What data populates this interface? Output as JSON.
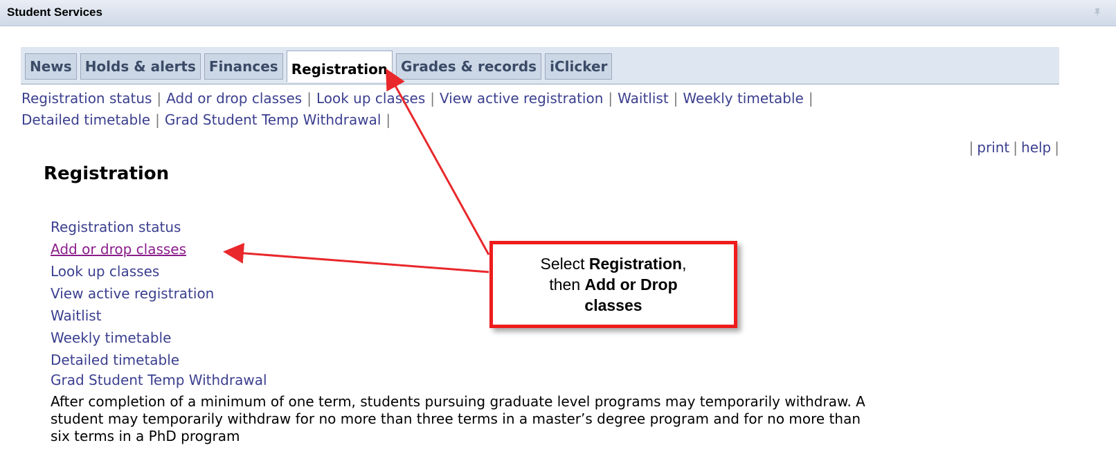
{
  "portlet": {
    "title": "Student Services"
  },
  "tabs": [
    {
      "label": "News",
      "active": false
    },
    {
      "label": "Holds & alerts",
      "active": false
    },
    {
      "label": "Finances",
      "active": false
    },
    {
      "label": "Registration",
      "active": true
    },
    {
      "label": "Grades & records",
      "active": false
    },
    {
      "label": "iClicker",
      "active": false
    }
  ],
  "sublinks": [
    "Registration status",
    "Add or drop classes",
    "Look up classes",
    "View active registration",
    "Waitlist",
    "Weekly timetable",
    "Detailed timetable",
    "Grad Student Temp Withdrawal"
  ],
  "utility": {
    "print": "print",
    "help": "help"
  },
  "page": {
    "title": "Registration"
  },
  "menu": [
    "Registration status",
    "Add or drop classes",
    "Look up classes",
    "View active registration",
    "Waitlist",
    "Weekly timetable",
    "Detailed timetable",
    "Grad Student Temp Withdrawal"
  ],
  "description": "After completion of a minimum of one term, students pursuing graduate level programs may temporarily withdraw. A student may temporarily withdraw for no more than three terms in a master’s degree program and for no more than six terms in a PhD program",
  "callout": {
    "line1_prefix": "Select ",
    "line1_bold": "Registration",
    "line1_suffix": ",",
    "line2_prefix": "then ",
    "line2_bold": "Add or Drop",
    "line3_bold": "classes"
  },
  "colors": {
    "link": "#3b3f8f",
    "visited_link": "#8a1d8a",
    "callout_border": "#ee1c1c",
    "arrow": "#e8282b"
  }
}
